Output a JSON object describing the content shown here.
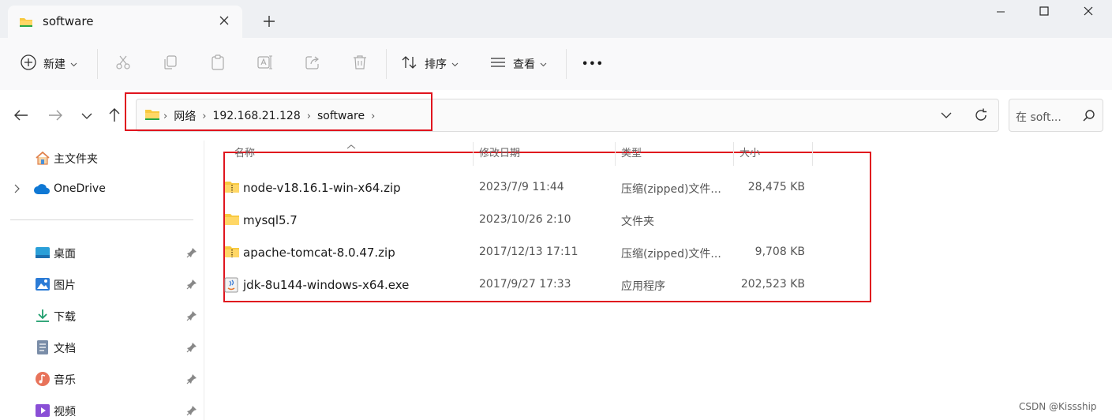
{
  "tab": {
    "title": "software"
  },
  "toolbar": {
    "new_label": "新建",
    "sort_label": "排序",
    "view_label": "查看",
    "more_label": "•••"
  },
  "breadcrumb": [
    "网络",
    "192.168.21.128",
    "software"
  ],
  "search": {
    "placeholder": "在 soft..."
  },
  "sidebar": {
    "top": [
      {
        "label": "主文件夹",
        "icon": "home-icon"
      },
      {
        "label": "OneDrive",
        "icon": "cloud-icon"
      }
    ],
    "pinned": [
      {
        "label": "桌面",
        "icon": "desktop-icon"
      },
      {
        "label": "图片",
        "icon": "pictures-icon"
      },
      {
        "label": "下载",
        "icon": "download-icon"
      },
      {
        "label": "文档",
        "icon": "documents-icon"
      },
      {
        "label": "音乐",
        "icon": "music-icon"
      },
      {
        "label": "视频",
        "icon": "videos-icon"
      }
    ]
  },
  "columns": {
    "name": "名称",
    "date": "修改日期",
    "type": "类型",
    "size": "大小"
  },
  "files": [
    {
      "name": "node-v18.16.1-win-x64.zip",
      "date": "2023/7/9 11:44",
      "type": "压缩(zipped)文件...",
      "size": "28,475 KB",
      "icon": "zip-folder-icon"
    },
    {
      "name": "mysql5.7",
      "date": "2023/10/26 2:10",
      "type": "文件夹",
      "size": "",
      "icon": "folder-icon"
    },
    {
      "name": "apache-tomcat-8.0.47.zip",
      "date": "2017/12/13 17:11",
      "type": "压缩(zipped)文件...",
      "size": "9,708 KB",
      "icon": "zip-folder-icon"
    },
    {
      "name": "jdk-8u144-windows-x64.exe",
      "date": "2017/9/27 17:33",
      "type": "应用程序",
      "size": "202,523 KB",
      "icon": "exe-icon"
    }
  ],
  "watermark": "CSDN @Kissship",
  "colors": {
    "accent": "#0067c0",
    "highlight": "#e0141e",
    "folder": "#f8c940"
  }
}
